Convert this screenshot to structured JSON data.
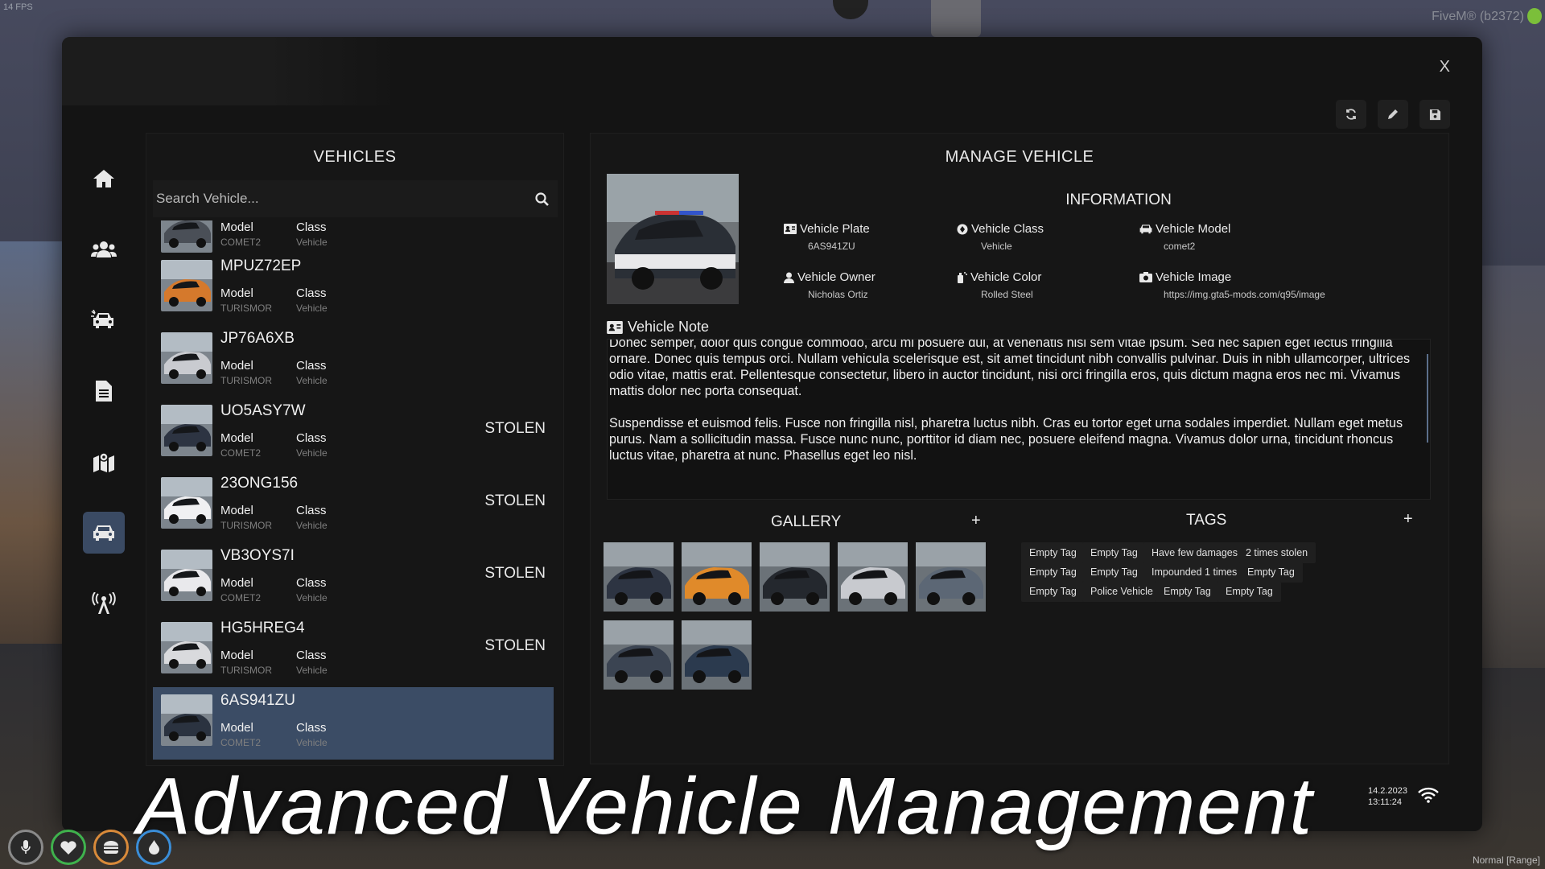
{
  "overlay": {
    "fps": "14 FPS",
    "fivem": "FiveM® (b2372)",
    "watermark": "Advanced Vehicle Management",
    "clock_line1": "14.2.2023",
    "clock_line2": "13:11:24",
    "voice_mode": "Normal [Range]"
  },
  "window": {
    "close_label": "X"
  },
  "vehicles": {
    "title": "VEHICLES",
    "search_placeholder": "Search Vehicle...",
    "model_label": "Model",
    "class_label": "Class",
    "items": [
      {
        "plate": "",
        "model": "COMET2",
        "class": "Vehicle",
        "stolen": "",
        "partial": true
      },
      {
        "plate": "MPUZ72EP",
        "model": "TURISMOR",
        "class": "Vehicle",
        "stolen": ""
      },
      {
        "plate": "JP76A6XB",
        "model": "TURISMOR",
        "class": "Vehicle",
        "stolen": ""
      },
      {
        "plate": "UO5ASY7W",
        "model": "COMET2",
        "class": "Vehicle",
        "stolen": "STOLEN"
      },
      {
        "plate": "23ONG156",
        "model": "TURISMOR",
        "class": "Vehicle",
        "stolen": "STOLEN"
      },
      {
        "plate": "VB3OYS7I",
        "model": "COMET2",
        "class": "Vehicle",
        "stolen": "STOLEN"
      },
      {
        "plate": "HG5HREG4",
        "model": "TURISMOR",
        "class": "Vehicle",
        "stolen": "STOLEN"
      },
      {
        "plate": "6AS941ZU",
        "model": "COMET2",
        "class": "Vehicle",
        "stolen": "",
        "selected": true
      }
    ]
  },
  "manage": {
    "title": "MANAGE VEHICLE",
    "info_title": "INFORMATION",
    "plate_label": "Vehicle Plate",
    "plate_value": "6AS941ZU",
    "class_label": "Vehicle Class",
    "class_value": "Vehicle",
    "model_label": "Vehicle Model",
    "model_value": "comet2",
    "owner_label": "Vehicle Owner",
    "owner_value": "Nicholas Ortiz",
    "color_label": "Vehicle Color",
    "color_value": "Rolled Steel",
    "image_label": "Vehicle Image",
    "image_value": "https://img.gta5-mods.com/q95/image",
    "note_label": "Vehicle Note",
    "note_text": "Donec semper, dolor quis congue commodo, arcu mi posuere dui, at venenatis nisl sem vitae ipsum. Sed nec sapien eget lectus fringilla ornare. Donec quis tempus orci. Nullam vehicula scelerisque est, sit amet tincidunt nibh convallis pulvinar. Duis in nibh ullamcorper, ultrices odio vitae, mattis erat. Pellentesque consectetur, libero in auctor tincidunt, nisi orci fringilla eros, quis dictum magna eros nec mi. Vivamus mattis dolor nec porta consequat.\n\nSuspendisse et euismod felis. Fusce non fringilla nisl, pharetra luctus nibh. Cras eu tortor eget urna sodales imperdiet. Nullam eget metus purus. Nam a sollicitudin massa. Fusce nunc nunc, porttitor id diam nec, posuere eleifend magna. Vivamus dolor urna, tincidunt rhoncus luctus vitae, pharetra at nunc. Phasellus eget leo nisl.",
    "gallery_title": "GALLERY",
    "gallery_add": "+",
    "tags_title": "TAGS",
    "tags_add": "+",
    "tags": [
      "Empty Tag",
      "Empty Tag",
      "Have few damages",
      "2 times stolen",
      "Empty Tag",
      "Empty Tag",
      "Impounded 1 times",
      "Empty Tag",
      "Empty Tag",
      "Police Vehicle",
      "Empty Tag",
      "Empty Tag"
    ]
  },
  "colors": {
    "accent": "#3b4c65",
    "panel": "#161616",
    "window": "#141414"
  },
  "icons": {
    "sidebar": [
      "home-icon",
      "users-icon",
      "car-crash-icon",
      "document-icon",
      "map-icon",
      "car-icon",
      "radio-tower-icon"
    ],
    "actions": [
      "refresh-icon",
      "pencil-icon",
      "save-icon"
    ]
  }
}
